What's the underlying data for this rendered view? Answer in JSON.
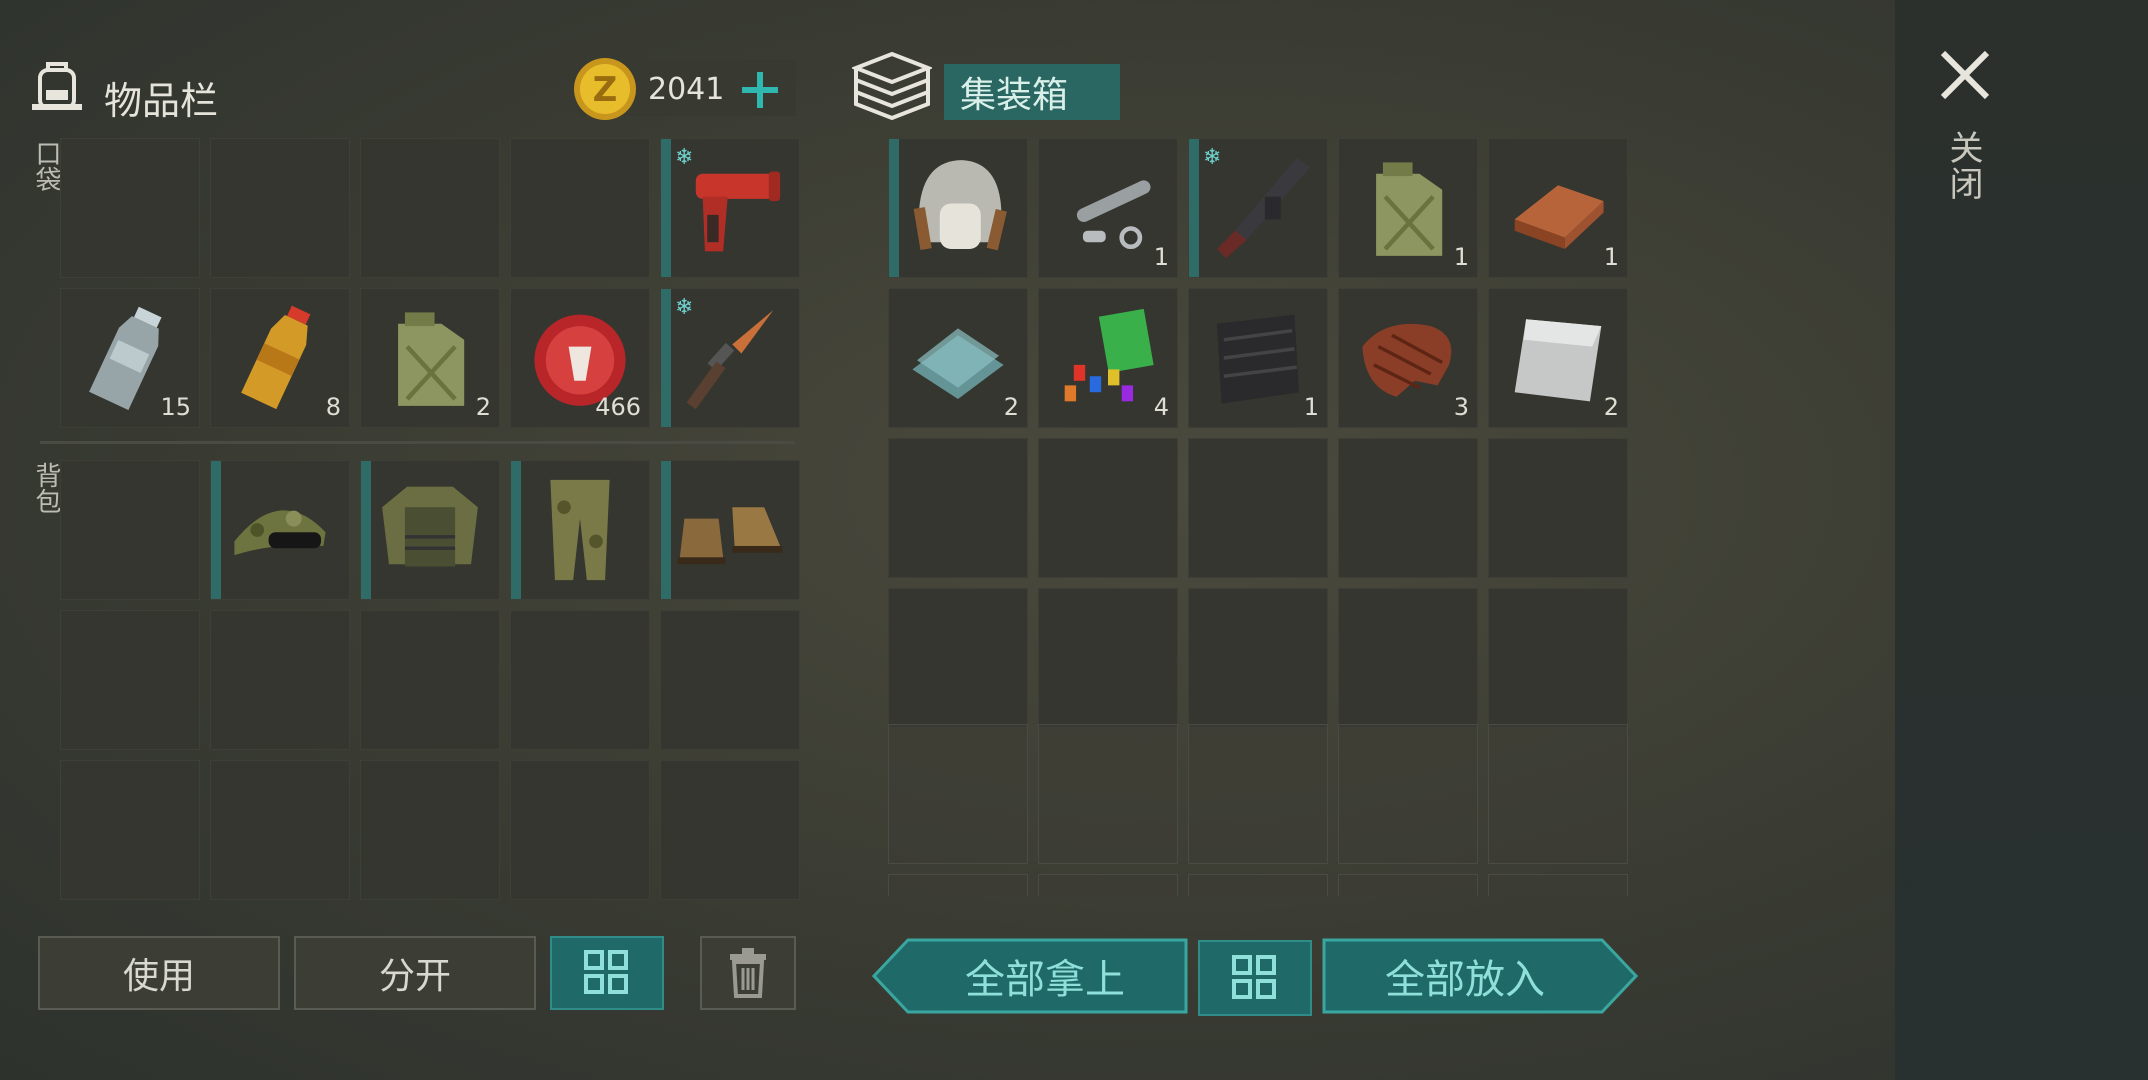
{
  "inventory": {
    "title": "物品栏",
    "coins": "2041",
    "pocket_label": "口袋",
    "backpack_label": "背包",
    "pocket_rows": [
      [
        {
          "name": "empty",
          "qty": ""
        },
        {
          "name": "empty",
          "qty": ""
        },
        {
          "name": "empty",
          "qty": ""
        },
        {
          "name": "empty",
          "qty": ""
        },
        {
          "name": "flare-gun",
          "qty": "",
          "snow": true,
          "marked": true
        }
      ],
      [
        {
          "name": "water-bottle",
          "qty": "15"
        },
        {
          "name": "soda-bottle",
          "qty": "8"
        },
        {
          "name": "jerrycan",
          "qty": "2"
        },
        {
          "name": "bottle-cap",
          "qty": "466"
        },
        {
          "name": "knife",
          "qty": "",
          "snow": true,
          "marked": true
        }
      ]
    ],
    "backpack_rows": [
      [
        {
          "name": "empty",
          "qty": ""
        },
        {
          "name": "camo-cap",
          "qty": "",
          "marked": true
        },
        {
          "name": "tactical-vest",
          "qty": "",
          "marked": true
        },
        {
          "name": "camo-pants",
          "qty": "",
          "marked": true
        },
        {
          "name": "boots",
          "qty": "",
          "marked": true
        }
      ],
      [
        {
          "name": "empty",
          "qty": ""
        },
        {
          "name": "empty",
          "qty": ""
        },
        {
          "name": "empty",
          "qty": ""
        },
        {
          "name": "empty",
          "qty": ""
        },
        {
          "name": "empty",
          "qty": ""
        }
      ],
      [
        {
          "name": "empty",
          "qty": ""
        },
        {
          "name": "empty",
          "qty": ""
        },
        {
          "name": "empty",
          "qty": ""
        },
        {
          "name": "empty",
          "qty": ""
        },
        {
          "name": "empty",
          "qty": ""
        }
      ]
    ],
    "buttons": {
      "use": "使用",
      "split": "分开"
    }
  },
  "container": {
    "title": "集装箱",
    "rows": [
      [
        {
          "name": "ushanka-hat",
          "qty": "",
          "marked": true
        },
        {
          "name": "pipe-parts",
          "qty": "1"
        },
        {
          "name": "rifle",
          "qty": "",
          "snow": true,
          "marked": true
        },
        {
          "name": "jerrycan",
          "qty": "1"
        },
        {
          "name": "copper-ingot",
          "qty": "1"
        }
      ],
      [
        {
          "name": "glass-panes",
          "qty": "2"
        },
        {
          "name": "plastic-scraps",
          "qty": "4"
        },
        {
          "name": "rubber-sheet",
          "qty": "1"
        },
        {
          "name": "steak",
          "qty": "3"
        },
        {
          "name": "metal-plate",
          "qty": "2"
        }
      ]
    ],
    "buttons": {
      "take_all": "全部拿上",
      "put_all": "全部放入"
    }
  },
  "close_label": "关闭",
  "colors": {
    "accent": "#1f6a68",
    "accent_text": "#8fe0da",
    "coin": "#e0b52a"
  }
}
